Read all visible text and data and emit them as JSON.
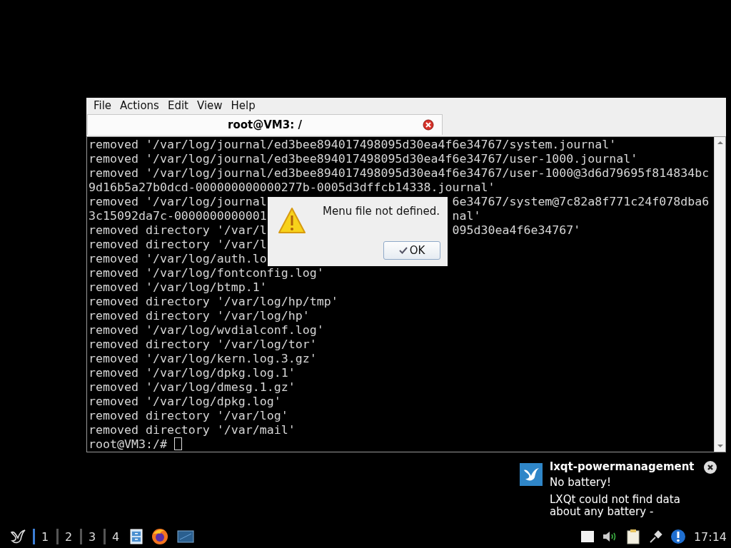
{
  "window": {
    "menu": [
      "File",
      "Actions",
      "Edit",
      "View",
      "Help"
    ],
    "tabs": [
      {
        "title": "root@VM3: /",
        "selected": true
      }
    ]
  },
  "terminal": {
    "lines": [
      {
        "text": "removed '/var/log/journal/ed3bee894017498095d30ea4f6e34767/system.journal'"
      },
      {
        "text": "removed '/var/log/journal/ed3bee894017498095d30ea4f6e34767/user-1000.journal'"
      },
      {
        "text": "removed '/var/log/journal/ed3bee894017498095d30ea4f6e34767/user-1000@3d6d79695f814834bc"
      },
      {
        "text": "9d16b5a27b0dcd-000000000000277b-0005d3dffcb14338.journal'"
      },
      {
        "text": "removed '/var/log/journal",
        "right": "6e34767/system@7c82a8f771c24f078dba6"
      },
      {
        "text": "3c15092da7c-0000000000001",
        "right": "nal'"
      },
      {
        "text": "removed directory '/var/l",
        "right": "095d30ea4f6e34767'"
      },
      {
        "text": "removed directory '/var/l"
      },
      {
        "text": "removed '/var/log/auth.lo"
      },
      {
        "text": "removed '/var/log/fontconfig.log'"
      },
      {
        "text": "removed '/var/log/btmp.1'"
      },
      {
        "text": "removed directory '/var/log/hp/tmp'"
      },
      {
        "text": "removed directory '/var/log/hp'"
      },
      {
        "text": "removed '/var/log/wvdialconf.log'"
      },
      {
        "text": "removed directory '/var/log/tor'"
      },
      {
        "text": "removed '/var/log/kern.log.3.gz'"
      },
      {
        "text": "removed '/var/log/dpkg.log.1'"
      },
      {
        "text": "removed '/var/log/dmesg.1.gz'"
      },
      {
        "text": "removed '/var/log/dpkg.log'"
      },
      {
        "text": "removed directory '/var/log'"
      },
      {
        "text": "removed directory '/var/mail'"
      }
    ],
    "prompt": "root@VM3:/# "
  },
  "dialog": {
    "message": "Menu file not defined.",
    "button": "OK"
  },
  "notification": {
    "app": "lxqt-powermanagement",
    "summary": "No battery!",
    "body": "LXQt could not find data about any battery -"
  },
  "taskbar": {
    "desktops": [
      {
        "label": "1",
        "selected": true
      },
      {
        "label": "2",
        "selected": false
      },
      {
        "label": "3",
        "selected": false
      },
      {
        "label": "4",
        "selected": false
      }
    ],
    "clock": "17:14"
  }
}
